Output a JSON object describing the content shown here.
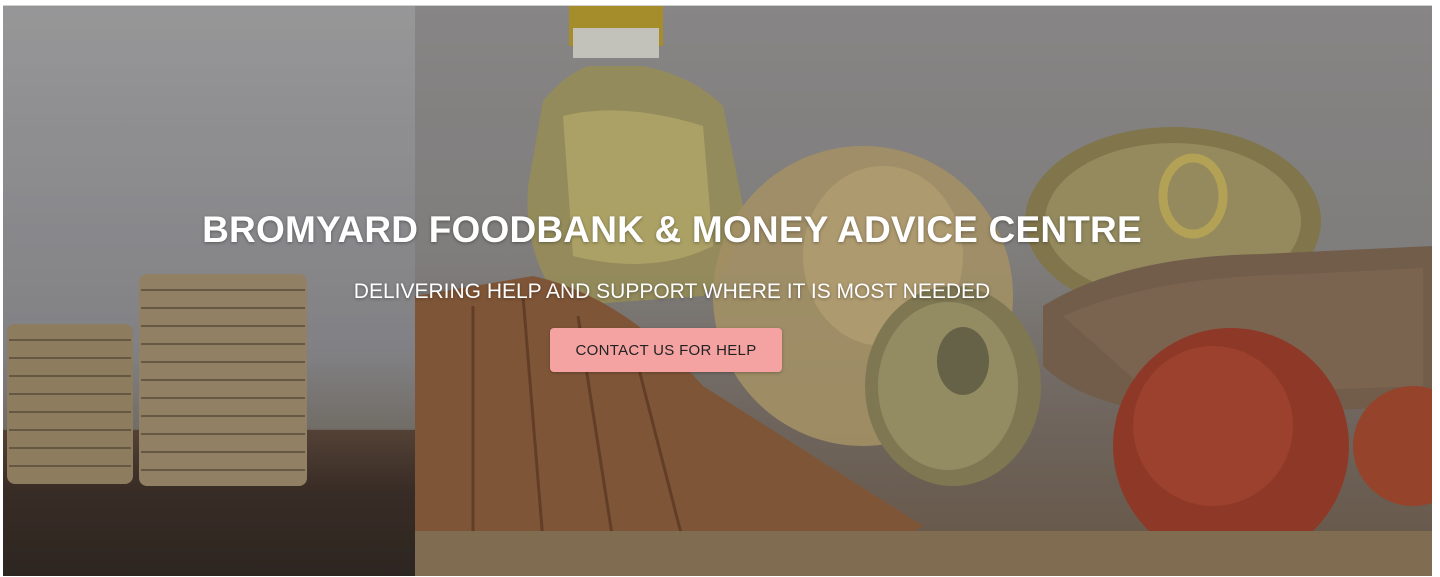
{
  "hero": {
    "title": "BROMYARD FOODBANK & MONEY ADVICE CENTRE",
    "subtitle": "DELIVERING HELP AND SUPPORT WHERE IT IS MOST NEEDED",
    "cta_label": "CONTACT US FOR HELP"
  },
  "colors": {
    "cta_background": "#f4a3a2",
    "text": "#ffffff"
  }
}
